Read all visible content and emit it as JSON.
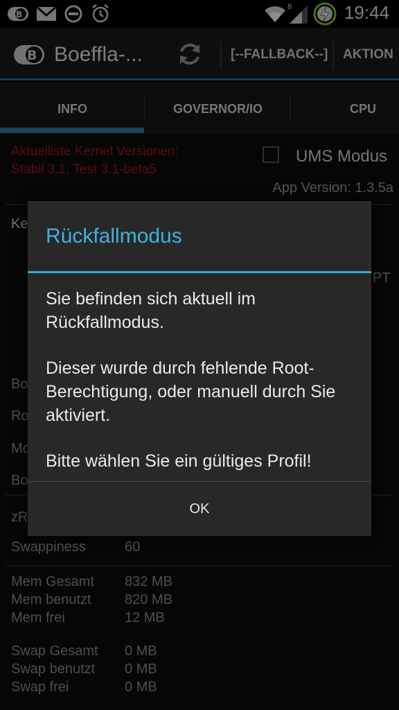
{
  "status_bar": {
    "time": "19:44",
    "signal_superscript": "8",
    "icons": [
      "boeffla-icon",
      "gmail-icon",
      "do-not-disturb-icon",
      "alarm-icon",
      "wifi-icon",
      "signal-icon",
      "battery-charging-icon"
    ]
  },
  "action_bar": {
    "title": "Boeffla-...",
    "fallback_label": "[--FALLBACK--]",
    "action_label": "AKTION"
  },
  "tabs": [
    {
      "label": "INFO",
      "selected": true
    },
    {
      "label": "GOVERNOR/IO",
      "selected": false
    },
    {
      "label": "CPU",
      "selected": false
    }
  ],
  "content": {
    "kernel_versions_line1": "Aktuelliste Kernel Versionen:",
    "kernel_versions_line2": "Stabil 3.1, Test 3.1-beta5",
    "ums_label": "UMS Modus",
    "app_version": "App Version: 1.3.5a",
    "partial_labels": {
      "ke": "Ke",
      "pt": "PT",
      "bo1": "Bo",
      "ro": "Ro",
      "mo": "Mo",
      "bo2": "Bo",
      "zr": "zR"
    },
    "swappiness_label": "Swappiness",
    "swappiness_value": "60",
    "mem": [
      {
        "label": "Mem Gesamt",
        "value": "832 MB"
      },
      {
        "label": "Mem benutzt",
        "value": "820 MB"
      },
      {
        "label": "Mem frei",
        "value": "12 MB"
      }
    ],
    "swap": [
      {
        "label": "Swap Gesamt",
        "value": "0 MB"
      },
      {
        "label": "Swap benutzt",
        "value": "0 MB"
      },
      {
        "label": "Swap frei",
        "value": "0 MB"
      }
    ]
  },
  "dialog": {
    "title": "Rückfallmodus",
    "paragraph1": "Sie befinden sich aktuell im Rückfallmodus.",
    "paragraph2": "Dieser wurde durch fehlende Root-Berechtigung, oder manuell durch Sie aktiviert.",
    "paragraph3": "Bitte wählen Sie ein gültiges Profil!",
    "ok_label": "OK"
  },
  "colors": {
    "accent": "#33a9dd",
    "red_text": "#a31515",
    "tab_indicator": "#2f7fa8"
  }
}
